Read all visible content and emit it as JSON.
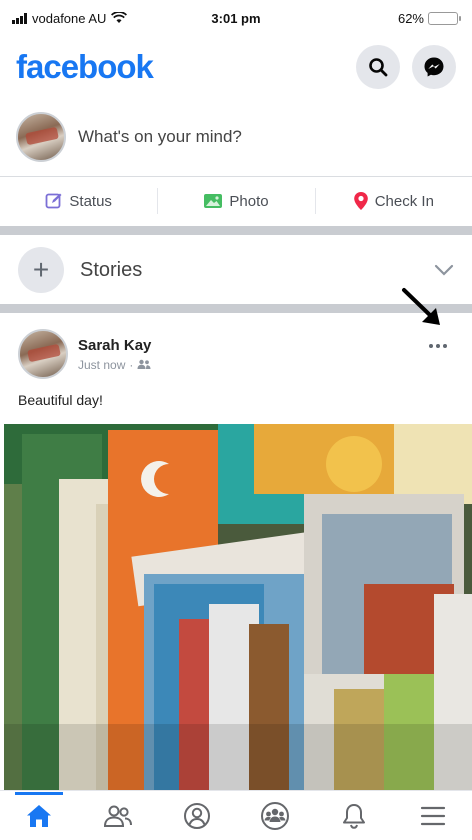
{
  "status_bar": {
    "carrier": "vodafone AU",
    "time": "3:01 pm",
    "battery": "62%",
    "battery_level": 0.62
  },
  "header": {
    "logo": "facebook",
    "search_icon": "search-icon",
    "messenger_icon": "messenger-icon"
  },
  "composer": {
    "prompt": "What's on your mind?"
  },
  "actions": [
    {
      "label": "Status",
      "icon": "status-edit-icon",
      "color": "#7b6fd6"
    },
    {
      "label": "Photo",
      "icon": "photo-icon",
      "color": "#45bd62"
    },
    {
      "label": "Check In",
      "icon": "location-pin-icon",
      "color": "#f02849"
    }
  ],
  "stories": {
    "label": "Stories"
  },
  "post": {
    "author": "Sarah Kay",
    "time": "Just now",
    "separator": "·",
    "audience_icon": "friends-icon",
    "text": "Beautiful day!"
  },
  "tabbar": {
    "items": [
      {
        "name": "home",
        "icon": "home-icon",
        "active": true
      },
      {
        "name": "friends",
        "icon": "friends-icon"
      },
      {
        "name": "profile",
        "icon": "profile-icon"
      },
      {
        "name": "groups",
        "icon": "groups-icon"
      },
      {
        "name": "notifications",
        "icon": "bell-icon"
      },
      {
        "name": "menu",
        "icon": "hamburger-menu-icon"
      }
    ]
  },
  "colors": {
    "brand": "#1877f2",
    "divider": "#c9ccd1"
  }
}
